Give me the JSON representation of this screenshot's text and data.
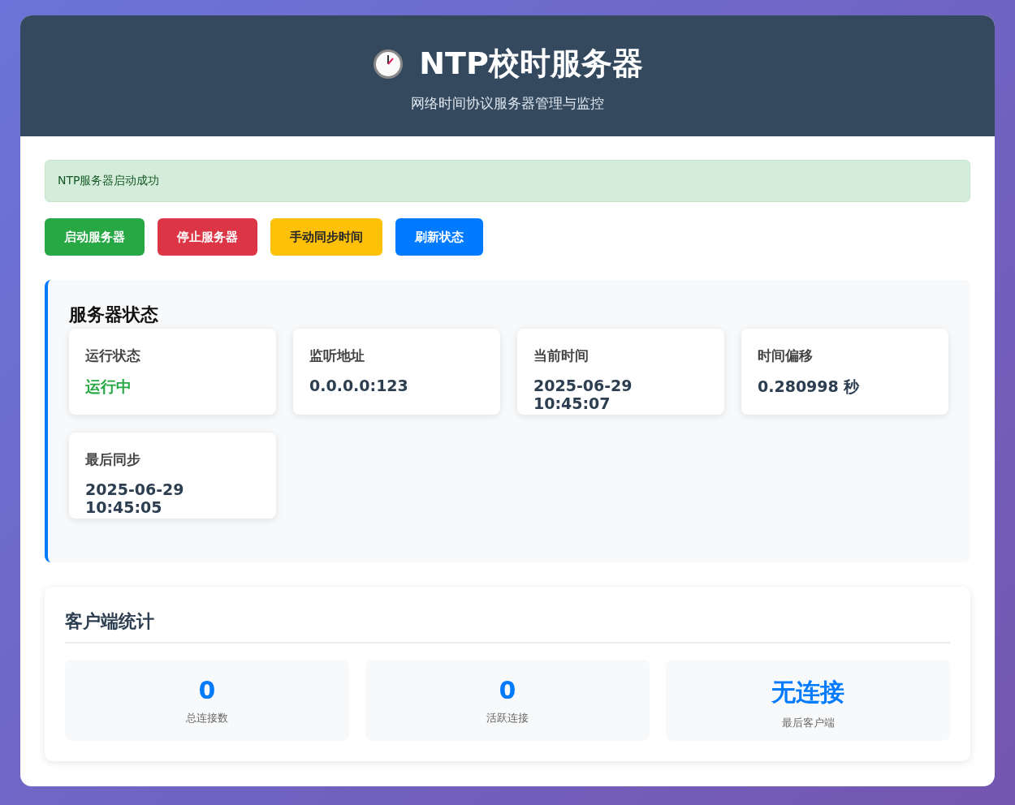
{
  "header": {
    "title": "NTP校时服务器",
    "subtitle": "网络时间协议服务器管理与监控"
  },
  "alert": {
    "kind": "success",
    "text": "NTP服务器启动成功"
  },
  "buttons": [
    {
      "label": "启动服务器",
      "kind": "success"
    },
    {
      "label": "停止服务器",
      "kind": "danger"
    },
    {
      "label": "手动同步时间",
      "kind": "warning"
    },
    {
      "label": "刷新状态",
      "kind": "primary"
    }
  ],
  "server_status": {
    "title": "服务器状态",
    "items": [
      {
        "label": "运行状态",
        "value": "运行中",
        "kind": "running"
      },
      {
        "label": "监听地址",
        "value": "0.0.0.0:123",
        "kind": "plain"
      },
      {
        "label": "当前时间",
        "value": "2025-06-29 10:45:07",
        "kind": "plain"
      },
      {
        "label": "时间偏移",
        "value": "0.280998 秒",
        "kind": "plain"
      },
      {
        "label": "最后同步",
        "value": "2025-06-29 10:45:05",
        "kind": "plain"
      }
    ]
  },
  "client_stats": {
    "title": "客户端统计",
    "items": [
      {
        "value": "0",
        "label": "总连接数"
      },
      {
        "value": "0",
        "label": "活跃连接"
      },
      {
        "value": "无连接",
        "label": "最后客户端"
      }
    ]
  }
}
